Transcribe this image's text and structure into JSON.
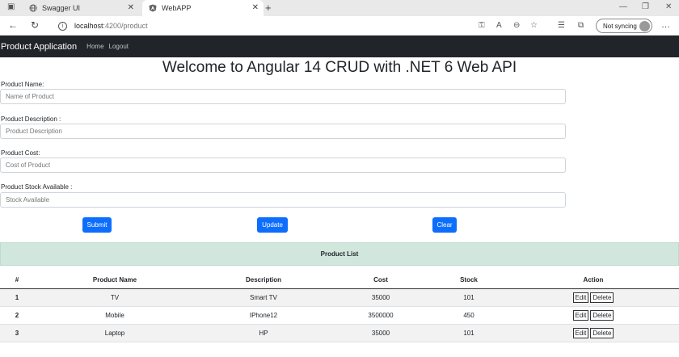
{
  "browser": {
    "tabs": [
      {
        "label": "Swagger UI",
        "icon": "globe-icon"
      },
      {
        "label": "WebAPP",
        "icon": "angular-icon",
        "active": true
      }
    ],
    "url_host": "localhost",
    "url_path": ":4200/product",
    "sync_label": "Not syncing"
  },
  "navbar": {
    "brand": "Product Application",
    "links": [
      "Home",
      "Logout"
    ]
  },
  "page": {
    "title": "Welcome to Angular 14 CRUD with .NET 6 Web API"
  },
  "form": {
    "fields": [
      {
        "label": "Product Name:",
        "placeholder": "Name of Product"
      },
      {
        "label": "Product Description :",
        "placeholder": "Product Description"
      },
      {
        "label": "Product Cost:",
        "placeholder": "Cost of Product"
      },
      {
        "label": "Product Stock Available :",
        "placeholder": "Stock Available"
      }
    ],
    "buttons": {
      "submit": "Submit",
      "update": "Update",
      "clear": "Clear"
    }
  },
  "list": {
    "heading": "Product List",
    "columns": [
      "#",
      "Product Name",
      "Description",
      "Cost",
      "Stock",
      "Action"
    ],
    "rows": [
      {
        "id": "1",
        "name": "TV",
        "description": "Smart TV",
        "cost": "35000",
        "stock": "101"
      },
      {
        "id": "2",
        "name": "Mobile",
        "description": "IPhone12",
        "cost": "3500000",
        "stock": "450"
      },
      {
        "id": "3",
        "name": "Laptop",
        "description": "HP",
        "cost": "35000",
        "stock": "101"
      }
    ],
    "edit_label": "Edit",
    "delete_label": "Delete"
  },
  "colors": {
    "navbar_bg": "#212529",
    "primary": "#0d6efd",
    "list_header_bg": "#d1e7dd"
  }
}
